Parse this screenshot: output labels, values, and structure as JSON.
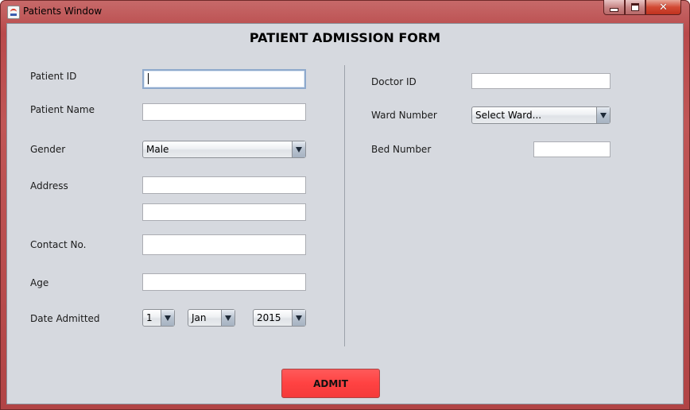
{
  "window": {
    "title": "Patients Window",
    "close_glyph": "✕"
  },
  "form": {
    "title": "PATIENT ADMISSION FORM",
    "labels": {
      "patient_id": "Patient ID",
      "patient_name": "Patient Name",
      "gender": "Gender",
      "address": "Address",
      "contact_no": "Contact No.",
      "age": "Age",
      "date_admitted": "Date Admitted",
      "doctor_id": "Doctor ID",
      "ward_number": "Ward Number",
      "bed_number": "Bed Number"
    },
    "values": {
      "patient_id": "",
      "patient_name": "",
      "address_line1": "",
      "address_line2": "",
      "contact_no": "",
      "age": "",
      "doctor_id": "",
      "bed_number": ""
    },
    "selects": {
      "gender": "Male",
      "day": "1",
      "month": "Jan",
      "year": "2015",
      "ward": "Select Ward..."
    },
    "admit_label": "ADMIT"
  },
  "colors": {
    "titlebar": "#c05656",
    "client_bg": "#d6d9df",
    "admit_button": "#ff4242"
  }
}
